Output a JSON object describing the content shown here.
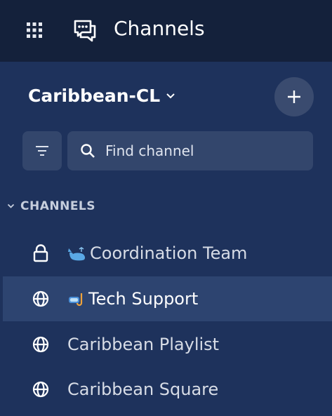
{
  "header": {
    "title": "Channels",
    "icons": {
      "apps": "grid-icon",
      "channels": "chat-bubbles-icon"
    }
  },
  "team": {
    "name": "Caribbean-CL",
    "dropdown_icon": "chevron-down-icon",
    "add_icon": "plus-icon"
  },
  "search": {
    "filter_icon": "filter-icon",
    "icon": "search-icon",
    "placeholder": "Find channel"
  },
  "sections": [
    {
      "title": "CHANNELS",
      "collapsed": false,
      "channels": [
        {
          "icon": "lock-icon",
          "emoji_icon": "whale-icon",
          "label": "Coordination Team",
          "active": false
        },
        {
          "icon": "globe-icon",
          "emoji_icon": "snorkel-mask-icon",
          "label": "Tech Support",
          "active": true
        },
        {
          "icon": "globe-icon",
          "label": "Caribbean Playlist",
          "active": false
        },
        {
          "icon": "globe-icon",
          "label": "Caribbean Square",
          "active": false
        }
      ]
    }
  ],
  "colors": {
    "topbar_bg": "#14213b",
    "sidebar_bg": "#1e325c",
    "active_row_bg": "#2d4470",
    "input_bg": "#33466c"
  }
}
